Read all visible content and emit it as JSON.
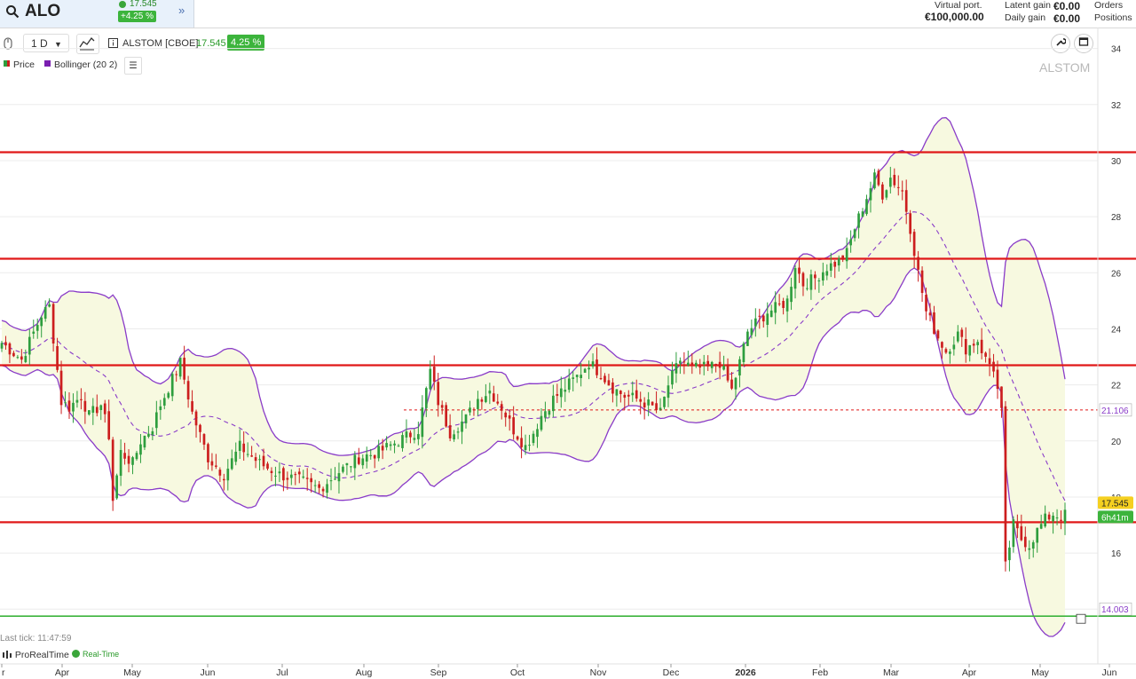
{
  "header": {
    "symbol": "ALO",
    "price": "17.545",
    "change": "+4.25 %",
    "virtual_port_label": "Virtual port.",
    "virtual_port_value": "€100,000.00",
    "latent_gain_label": "Latent gain",
    "latent_gain_value": "€0.00",
    "daily_gain_label": "Daily gain",
    "daily_gain_value": "€0.00",
    "orders_label": "Orders",
    "positions_label": "Positions"
  },
  "toolbar": {
    "timeframe": "1 D",
    "instrument": "ALSTOM [CBOE]",
    "price": "17.545",
    "change": "4.25 %"
  },
  "legend": {
    "price_label": "Price",
    "bollinger_label": "Bollinger (20 2)"
  },
  "watermark": "ALSTOM",
  "footer": {
    "last_tick": "Last tick: 11:47:59",
    "brand": "ProRealTime",
    "realtime": "Real-Time"
  },
  "colors": {
    "up": "#2e9e3e",
    "down": "#cc1e1e",
    "bollinger": "#8a3cc8",
    "band_fill": "#f7f9e0",
    "hline": "#e01818",
    "support": "#3cb43c",
    "price_tag": "#f5d020",
    "timer_tag": "#3cb43c"
  },
  "chart_data": {
    "type": "candlestick",
    "ylim": [
      12.3,
      34.4
    ],
    "y_ticks": [
      14,
      16,
      18,
      20,
      22,
      24,
      26,
      28,
      30,
      32,
      34
    ],
    "x_labels": [
      "r",
      "Apr",
      "May",
      "Jun",
      "Jul",
      "Aug",
      "Sep",
      "Oct",
      "Nov",
      "Dec",
      "2026",
      "Feb",
      "Mar",
      "Apr",
      "May",
      "Jun"
    ],
    "x_label_bold": "2026",
    "horizontal_lines": [
      {
        "value": 30.3,
        "color": "red"
      },
      {
        "value": 26.5,
        "color": "red"
      },
      {
        "value": 22.7,
        "color": "red"
      },
      {
        "value": 17.1,
        "color": "red"
      },
      {
        "value": 13.75,
        "color": "green"
      }
    ],
    "dashed_level": 21.106,
    "last_price_tag": "17.545",
    "timer_tag": "6h41m",
    "level_tag_1": "21.106",
    "level_tag_2": "14.003",
    "close_path": [
      [
        0,
        23.5
      ],
      [
        5,
        22.9
      ],
      [
        10,
        24.5
      ],
      [
        12,
        24.8
      ],
      [
        15,
        21.4
      ],
      [
        17,
        21.2
      ],
      [
        20,
        21.6
      ],
      [
        22,
        20.9
      ],
      [
        25,
        21.3
      ],
      [
        27,
        20.2
      ],
      [
        28,
        17.9
      ],
      [
        30,
        19.6
      ],
      [
        33,
        19.2
      ],
      [
        35,
        20.0
      ],
      [
        38,
        20.5
      ],
      [
        40,
        21.3
      ],
      [
        42,
        21.9
      ],
      [
        45,
        22.8
      ],
      [
        48,
        21.0
      ],
      [
        52,
        19.4
      ],
      [
        56,
        18.8
      ],
      [
        60,
        19.8
      ],
      [
        65,
        19.2
      ],
      [
        70,
        18.8
      ],
      [
        75,
        18.6
      ],
      [
        80,
        18.3
      ],
      [
        85,
        18.9
      ],
      [
        90,
        19.4
      ],
      [
        95,
        19.6
      ],
      [
        100,
        20.0
      ],
      [
        105,
        20.4
      ],
      [
        108,
        22.5
      ],
      [
        110,
        21.4
      ],
      [
        113,
        20.3
      ],
      [
        117,
        20.8
      ],
      [
        120,
        21.5
      ],
      [
        123,
        21.8
      ],
      [
        126,
        21.2
      ],
      [
        129,
        20.4
      ],
      [
        132,
        19.8
      ],
      [
        134,
        20.3
      ],
      [
        136,
        20.9
      ],
      [
        139,
        21.5
      ],
      [
        142,
        21.9
      ],
      [
        145,
        22.3
      ],
      [
        148,
        22.8
      ],
      [
        151,
        22.4
      ],
      [
        154,
        21.9
      ],
      [
        157,
        21.6
      ],
      [
        160,
        21.5
      ],
      [
        163,
        21.3
      ],
      [
        166,
        21.0
      ],
      [
        168,
        22.0
      ],
      [
        171,
        22.9
      ],
      [
        174,
        22.6
      ],
      [
        178,
        22.6
      ],
      [
        181,
        22.8
      ],
      [
        184,
        21.8
      ],
      [
        186,
        22.8
      ],
      [
        188,
        23.9
      ],
      [
        190,
        24.2
      ],
      [
        193,
        24.6
      ],
      [
        196,
        24.8
      ],
      [
        198,
        25.0
      ],
      [
        200,
        26.3
      ],
      [
        202,
        25.6
      ],
      [
        205,
        25.8
      ],
      [
        208,
        26.2
      ],
      [
        211,
        26.4
      ],
      [
        213,
        26.7
      ],
      [
        215,
        27.6
      ],
      [
        218,
        28.7
      ],
      [
        220,
        29.4
      ],
      [
        222,
        28.8
      ],
      [
        224,
        29.4
      ],
      [
        227,
        28.9
      ],
      [
        229,
        27.6
      ],
      [
        231,
        26.0
      ],
      [
        233,
        24.6
      ],
      [
        236,
        23.7
      ],
      [
        238,
        23.2
      ],
      [
        241,
        23.8
      ],
      [
        243,
        23.3
      ],
      [
        246,
        23.6
      ],
      [
        248,
        22.9
      ],
      [
        250,
        22.6
      ],
      [
        252,
        21.0
      ],
      [
        253,
        15.5
      ],
      [
        255,
        17.0
      ],
      [
        257,
        16.5
      ],
      [
        259,
        16.3
      ],
      [
        261,
        16.8
      ],
      [
        263,
        17.2
      ],
      [
        265,
        17.4
      ],
      [
        267,
        17.3
      ],
      [
        268,
        17.55
      ]
    ]
  }
}
